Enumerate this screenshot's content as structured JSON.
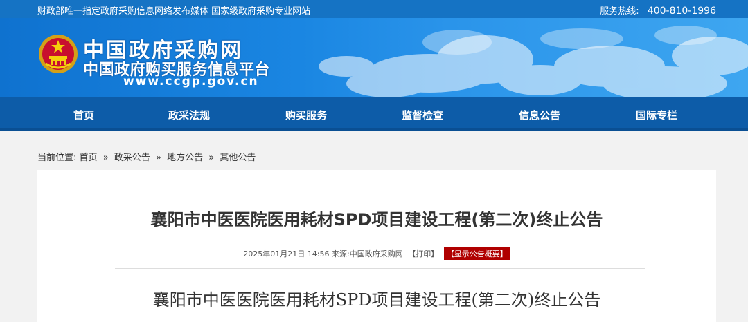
{
  "topbar": {
    "left_text": "财政部唯一指定政府采购信息网络发布媒体 国家级政府采购专业网站",
    "hotline_label": "服务热线:",
    "hotline_number": "400-810-1996"
  },
  "header": {
    "site_name": "中国政府采购网",
    "site_subtitle": "中国政府购买服务信息平台",
    "site_url": "www.ccgp.gov.cn"
  },
  "nav": {
    "items": [
      "首页",
      "政采法规",
      "购买服务",
      "监督检查",
      "信息公告",
      "国际专栏"
    ]
  },
  "breadcrumb": {
    "label": "当前位置:",
    "items": [
      "首页",
      "政采公告",
      "地方公告",
      "其他公告"
    ],
    "separator": "»"
  },
  "article": {
    "title": "襄阳市中医医院医用耗材SPD项目建设工程(第二次)终止公告",
    "datetime": "2025年01月21日 14:56",
    "source": "来源:中国政府采购网",
    "print_label": "【打印】",
    "summary_label": "【显示公告概要】",
    "body_title": "襄阳市中医医院医用耗材SPD项目建设工程(第二次)终止公告"
  },
  "colors": {
    "topbar": "#1573c4",
    "nav": "#0d5ca8",
    "badge": "#b00000"
  }
}
